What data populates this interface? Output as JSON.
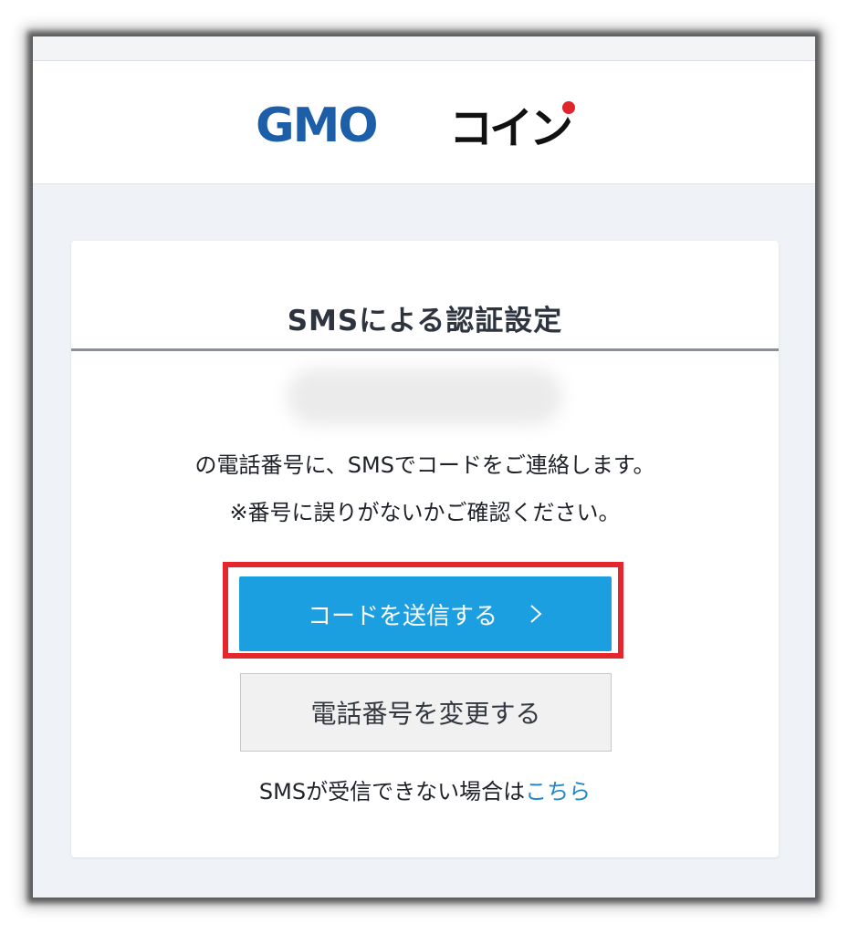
{
  "brand": {
    "logo_text_latin": "GMO",
    "logo_text_kana": "コイン",
    "colors": {
      "gmo_blue": "#1c5ea8",
      "kana_black": "#111111",
      "dot_red": "#e0242b"
    }
  },
  "card": {
    "title": "SMSによる認証設定",
    "phone_number_hidden": "",
    "message_line1": "の電話番号に、SMSでコードをご連絡します。",
    "message_line2": "※番号に誤りがないかご確認ください。"
  },
  "actions": {
    "send_code_label": "コードを送信する",
    "send_code_icon": "chevron-right-icon",
    "change_phone_label": "電話番号を変更する"
  },
  "help": {
    "prefix": "SMSが受信できない場合は",
    "link_label": "こちら"
  },
  "colors": {
    "primary_button": "#1c9fe0",
    "highlight_border": "#e5262c",
    "link": "#1f86c9"
  }
}
